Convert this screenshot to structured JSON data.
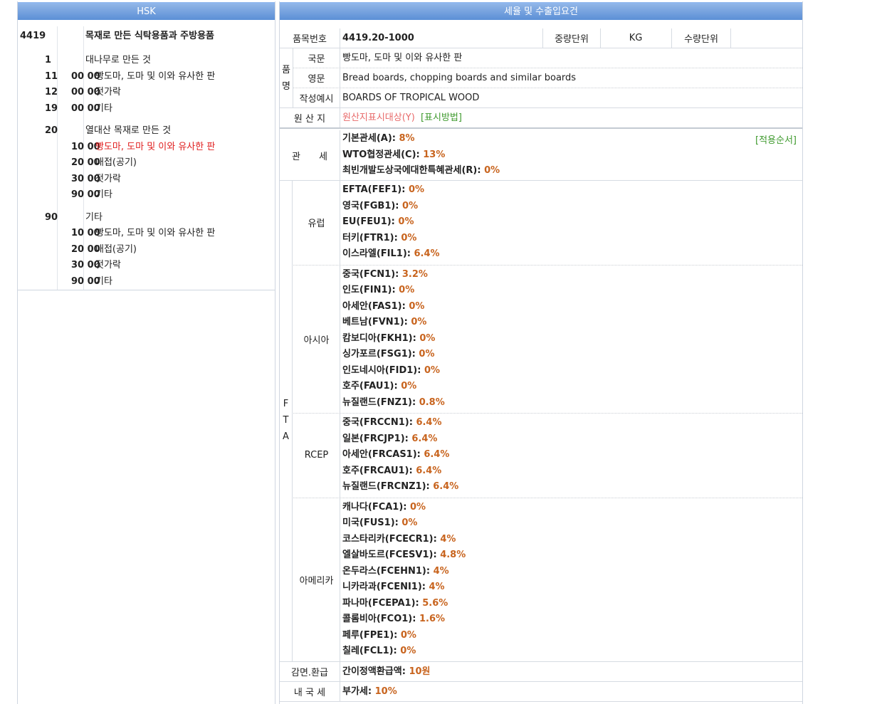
{
  "left": {
    "header": "HSK",
    "heading": {
      "code": "4419",
      "desc": "목재로 만든 식탁용품과 주방용품"
    },
    "rows": [
      {
        "c2": "1",
        "c3": "",
        "desc": "대나무로 만든 것",
        "indent": 0,
        "red": false,
        "gap": true
      },
      {
        "c2": "11",
        "c3": "00 00",
        "desc": "빵도마, 도마 및 이와 유사한 판",
        "indent": 1,
        "red": false,
        "gap": false
      },
      {
        "c2": "12",
        "c3": "00 00",
        "desc": "젓가락",
        "indent": 1,
        "red": false,
        "gap": false
      },
      {
        "c2": "19",
        "c3": "00 00",
        "desc": "기타",
        "indent": 1,
        "red": false,
        "gap": false
      },
      {
        "c2": "20",
        "c3": "",
        "desc": "열대산 목재로 만든 것",
        "indent": 0,
        "red": false,
        "gap": true
      },
      {
        "c2": "",
        "c3": "10 00",
        "desc": "빵도마, 도마 및 이와 유사한 판",
        "indent": 1,
        "red": true,
        "gap": false
      },
      {
        "c2": "",
        "c3": "20 00",
        "desc": "대접(공기)",
        "indent": 1,
        "red": false,
        "gap": false
      },
      {
        "c2": "",
        "c3": "30 00",
        "desc": "젓가락",
        "indent": 1,
        "red": false,
        "gap": false
      },
      {
        "c2": "",
        "c3": "90 00",
        "desc": "기타",
        "indent": 1,
        "red": false,
        "gap": false
      },
      {
        "c2": "90",
        "c3": "",
        "desc": "기타",
        "indent": 0,
        "red": false,
        "gap": true
      },
      {
        "c2": "",
        "c3": "10 00",
        "desc": "빵도마, 도마 및 이와 유사한 판",
        "indent": 1,
        "red": false,
        "gap": false
      },
      {
        "c2": "",
        "c3": "20 00",
        "desc": "대접(공기)",
        "indent": 1,
        "red": false,
        "gap": false
      },
      {
        "c2": "",
        "c3": "30 00",
        "desc": "젓가락",
        "indent": 1,
        "red": false,
        "gap": false
      },
      {
        "c2": "",
        "c3": "90 00",
        "desc": "기타",
        "indent": 1,
        "red": false,
        "gap": false
      }
    ]
  },
  "right": {
    "header": "세율 및 수출입요건",
    "item_label": "품목번호",
    "item_value": "4419.20-1000",
    "weight_label": "중량단위",
    "weight_value": "KG",
    "qty_label": "수량단위",
    "name_group": "품명",
    "korean_label": "국문",
    "korean_value": "빵도마, 도마 및 이와 유사한 판",
    "english_label": "영문",
    "english_value": "Bread boards, chopping boards and similar boards",
    "example_label": "작성예시",
    "example_value": "BOARDS OF TROPICAL WOOD",
    "origin_label": "원 산 지",
    "origin_link": "원산지표시대상(Y)",
    "origin_method": "[표시방법]",
    "tariff_label": "관　　세",
    "apply_order": "[적용순서]",
    "tariffs": [
      {
        "name": "기본관세(A): ",
        "rate": "8%"
      },
      {
        "name": "WTO협정관세(C): ",
        "rate": "13%"
      },
      {
        "name": "최빈개발도상국에대한특혜관세(R): ",
        "rate": "0%"
      }
    ],
    "fta_label": "FTA",
    "fta_groups": [
      {
        "name": "유럽",
        "items": [
          {
            "name": "EFTA(FEF1): ",
            "rate": "0%"
          },
          {
            "name": "영국(FGB1): ",
            "rate": "0%"
          },
          {
            "name": "EU(FEU1): ",
            "rate": "0%"
          },
          {
            "name": "터키(FTR1): ",
            "rate": "0%"
          },
          {
            "name": "이스라엘(FIL1): ",
            "rate": "6.4%"
          }
        ]
      },
      {
        "name": "아시아",
        "items": [
          {
            "name": "중국(FCN1): ",
            "rate": "3.2%"
          },
          {
            "name": "인도(FIN1): ",
            "rate": "0%"
          },
          {
            "name": "아세안(FAS1): ",
            "rate": "0%"
          },
          {
            "name": "베트남(FVN1): ",
            "rate": "0%"
          },
          {
            "name": "캄보디아(FKH1): ",
            "rate": "0%"
          },
          {
            "name": "싱가포르(FSG1): ",
            "rate": "0%"
          },
          {
            "name": "인도네시아(FID1): ",
            "rate": "0%"
          },
          {
            "name": "호주(FAU1): ",
            "rate": "0%"
          },
          {
            "name": "뉴질랜드(FNZ1): ",
            "rate": "0.8%"
          }
        ]
      },
      {
        "name": "RCEP",
        "items": [
          {
            "name": "중국(FRCCN1): ",
            "rate": "6.4%"
          },
          {
            "name": "일본(FRCJP1): ",
            "rate": "6.4%"
          },
          {
            "name": "아세안(FRCAS1): ",
            "rate": "6.4%"
          },
          {
            "name": "호주(FRCAU1): ",
            "rate": "6.4%"
          },
          {
            "name": "뉴질랜드(FRCNZ1): ",
            "rate": "6.4%"
          }
        ]
      },
      {
        "name": "아메리카",
        "items": [
          {
            "name": "캐나다(FCA1): ",
            "rate": "0%"
          },
          {
            "name": "미국(FUS1): ",
            "rate": "0%"
          },
          {
            "name": "코스타리카(FCECR1): ",
            "rate": "4%"
          },
          {
            "name": "엘살바도르(FCESV1): ",
            "rate": "4.8%"
          },
          {
            "name": "온두라스(FCEHN1): ",
            "rate": "4%"
          },
          {
            "name": "니카라과(FCENI1): ",
            "rate": "4%"
          },
          {
            "name": "파나마(FCEPA1): ",
            "rate": "5.6%"
          },
          {
            "name": "콜롬비아(FCO1): ",
            "rate": "1.6%"
          },
          {
            "name": "페루(FPE1): ",
            "rate": "0%"
          },
          {
            "name": "칠레(FCL1): ",
            "rate": "0%"
          }
        ]
      }
    ],
    "refund_label": "감면.환급",
    "refund_name": "간이정액환급액: ",
    "refund_value": "10원",
    "domestic_label": "내 국 세",
    "domestic_name": "부가세: ",
    "domestic_value": "10%"
  }
}
